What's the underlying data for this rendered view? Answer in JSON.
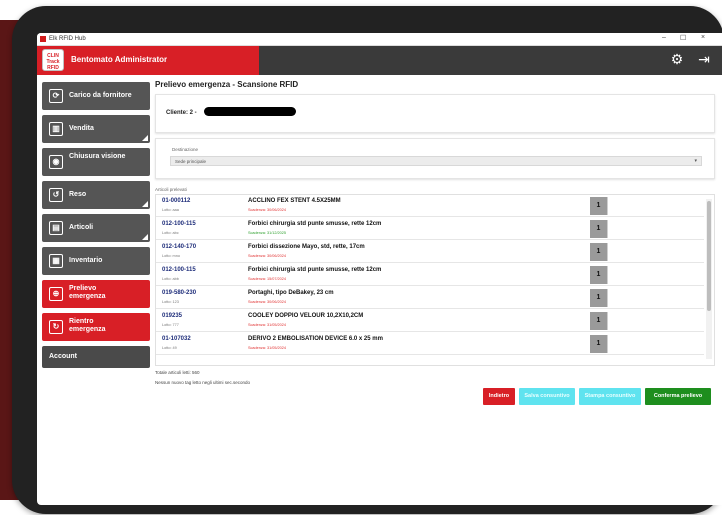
{
  "window": {
    "title": "Elk RFID Hub",
    "minimize": "–",
    "maximize": "☐",
    "close": "×"
  },
  "header": {
    "logo_line1": "CLIN",
    "logo_line2": "Track",
    "logo_line3": "RFID",
    "brand_title": "Bentomato Administrator",
    "settings_glyph": "⚙",
    "logout_glyph": "⇥"
  },
  "sidebar": {
    "items": [
      {
        "label": "Carico da fornitore",
        "glyph": "⟳",
        "color": "#555555"
      },
      {
        "label": "Vendita",
        "glyph": "▥",
        "color": "#555555"
      },
      {
        "label": "Chiusura visione",
        "glyph": "◉",
        "color": "#555555"
      },
      {
        "label": "Reso",
        "glyph": "↺",
        "color": "#555555"
      },
      {
        "label": "Articoli",
        "glyph": "▤",
        "color": "#555555"
      },
      {
        "label": "Inventario",
        "glyph": "▦",
        "color": "#555555"
      },
      {
        "label": "Prelievo emergenza",
        "glyph": "⊕",
        "color": "#d81f26"
      },
      {
        "label": "Rientro emergenza",
        "glyph": "↻",
        "color": "#d81f26"
      }
    ],
    "account_label": "Account"
  },
  "main": {
    "page_title": "Prelievo emergenza - Scansione RFID",
    "client_label": "Cliente: 2 -",
    "destination_label": "Destinazione",
    "destination_value": "Sede principale",
    "list_heading": "Articoli prelevati",
    "items": [
      {
        "code": "01-000112",
        "lotto": "Lotto: aaa",
        "desc": "ACCLINO FEX STENT 4.5X25MM",
        "exp": "Scadenza: 30/06/2024",
        "exp_color": "red",
        "qty": "1"
      },
      {
        "code": "012-100-115",
        "lotto": "Lotto: abc",
        "desc": "Forbici chirurgia std punte smusse, rette 12cm",
        "exp": "Scadenza: 31/12/2025",
        "exp_color": "green",
        "qty": "1"
      },
      {
        "code": "012-140-170",
        "lotto": "Lotto: mno",
        "desc": "Forbici dissezione Mayo, std, rette, 17cm",
        "exp": "Scadenza: 30/06/2024",
        "exp_color": "red",
        "qty": "1"
      },
      {
        "code": "012-100-115",
        "lotto": "Lotto: abb",
        "desc": "Forbici chirurgia std punte smusse, rette 12cm",
        "exp": "Scadenza: 15/07/2024",
        "exp_color": "red",
        "qty": "1"
      },
      {
        "code": "019-580-230",
        "lotto": "Lotto: 123",
        "desc": "Portaghi, tipo DeBakey, 23 cm",
        "exp": "Scadenza: 30/06/2024",
        "exp_color": "red",
        "qty": "1"
      },
      {
        "code": "019235",
        "lotto": "Lotto: 777",
        "desc": "COOLEY DOPPIO VELOUR 10,2X10,2CM",
        "exp": "Scadenza: 31/05/2024",
        "exp_color": "red",
        "qty": "1"
      },
      {
        "code": "01-107032",
        "lotto": "Lotto: 49",
        "desc": "DERIVO 2 EMBOLISATION DEVICE 6.0 x 25 mm",
        "exp": "Scadenza: 31/05/2024",
        "exp_color": "red",
        "qty": "1"
      }
    ],
    "totals": "Totale articoli letti: 560",
    "notice": "Nessun nuovo tag letto negli ultimi sec.secondo",
    "buttons": {
      "back": "Indietro",
      "cyan1": "Salva consuntivo",
      "cyan2": "Stampa consuntivo",
      "confirm": "Conferma prelievo"
    }
  },
  "colors": {
    "brand_red": "#d81f26",
    "header_dark": "#3a3a3a",
    "sidebar_gray": "#555555",
    "confirm_green": "#1e8e1e",
    "cyan_button": "#5fe3ef",
    "code_blue": "#1e2d7a"
  }
}
